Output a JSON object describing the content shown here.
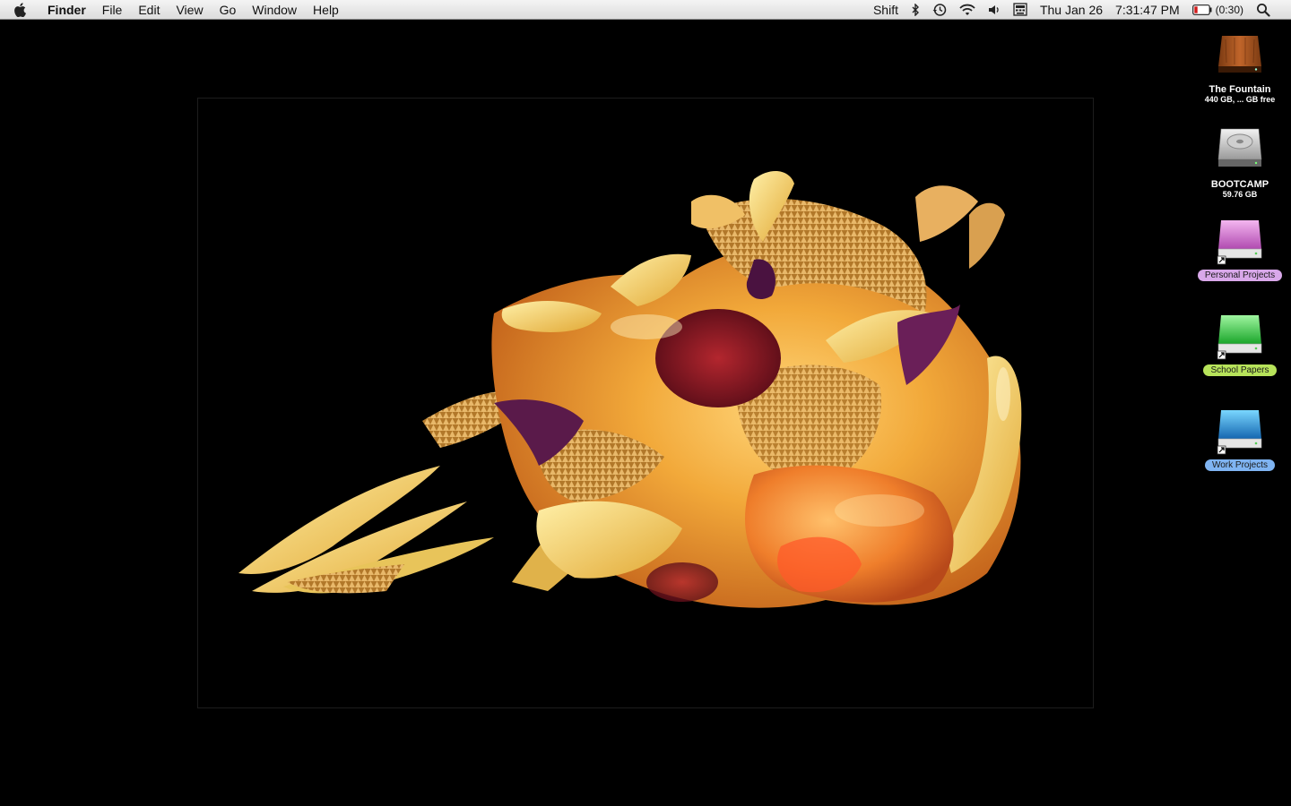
{
  "menubar": {
    "app_name": "Finder",
    "menus": [
      "File",
      "Edit",
      "View",
      "Go",
      "Window",
      "Help"
    ],
    "input_source": "Shift",
    "date": "Thu Jan 26",
    "time": "7:31:47 PM",
    "battery_time": "(0:30)",
    "status_icons": [
      "bluetooth-icon",
      "time-machine-icon",
      "wifi-icon",
      "volume-icon",
      "keyboard-viewer-icon",
      "battery-icon",
      "spotlight-icon"
    ]
  },
  "desktop": {
    "icons": [
      {
        "name": "The Fountain",
        "sub": "440 GB, ... GB free",
        "kind": "wood-drive",
        "label_color": null
      },
      {
        "name": "BOOTCAMP",
        "sub": "59.76 GB",
        "kind": "hard-drive",
        "label_color": null
      },
      {
        "name": "Personal Projects",
        "sub": null,
        "kind": "purple-drive-alias",
        "label_color": "#d9a8ea"
      },
      {
        "name": "School Papers",
        "sub": null,
        "kind": "green-drive-alias",
        "label_color": "#b7e35a"
      },
      {
        "name": "Work Projects",
        "sub": null,
        "kind": "blue-drive-alias",
        "label_color": "#7fb4f2"
      }
    ]
  },
  "colors": {
    "desktop_bg": "#000000",
    "wallpaper_warm": "#f2b43c",
    "wallpaper_purple": "#5a1a4a"
  }
}
